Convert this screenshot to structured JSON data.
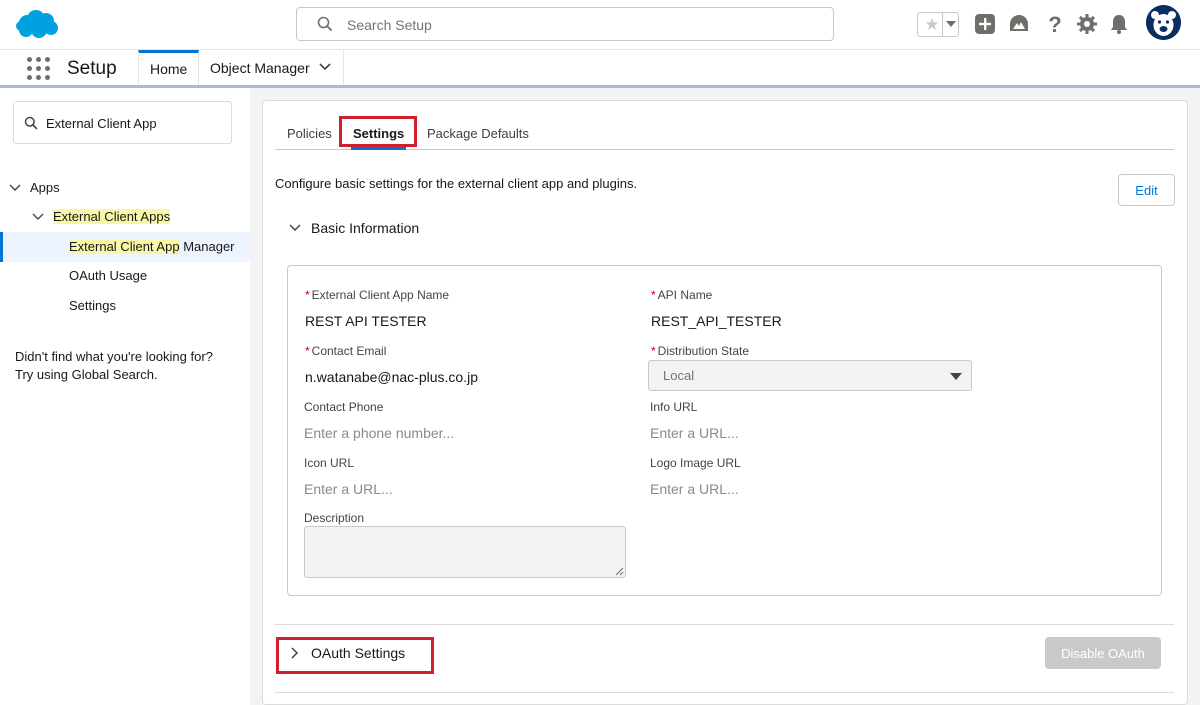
{
  "header": {
    "search_placeholder": "Search Setup",
    "icons": [
      "salesforce-cloud-logo",
      "search-icon",
      "favorites-star-icon",
      "add-icon",
      "trailhead-icon",
      "help-icon",
      "gear-icon",
      "bell-icon",
      "avatar"
    ]
  },
  "nav": {
    "app_name": "Setup",
    "tabs": [
      {
        "label": "Home"
      },
      {
        "label": "Object Manager"
      }
    ]
  },
  "sidebar": {
    "quickfind_value": "External Client App",
    "tree": [
      {
        "label": "Apps"
      },
      {
        "label": "External Client Apps"
      },
      {
        "label_hl": "External Client App",
        "label_rest": " Manager"
      },
      {
        "label": "OAuth Usage"
      },
      {
        "label": "Settings"
      }
    ],
    "help_line1": "Didn't find what you're looking for?",
    "help_line2": "Try using Global Search."
  },
  "main": {
    "tabs": [
      "Policies",
      "Settings",
      "Package Defaults"
    ],
    "active_tab": "Settings",
    "description": "Configure basic settings for the external client app and plugins.",
    "edit_label": "Edit",
    "basic_info_title": "Basic Information",
    "fields": {
      "app_name_label": "External Client App Name",
      "app_name_value": "REST API TESTER",
      "api_name_label": "API Name",
      "api_name_value": "REST_API_TESTER",
      "contact_email_label": "Contact Email",
      "contact_email_value": "n.watanabe@nac-plus.co.jp",
      "distribution_label": "Distribution State",
      "distribution_value": "Local",
      "contact_phone_label": "Contact Phone",
      "contact_phone_placeholder": "Enter a phone number...",
      "info_url_label": "Info URL",
      "info_url_placeholder": "Enter a URL...",
      "icon_url_label": "Icon URL",
      "icon_url_placeholder": "Enter a URL...",
      "logo_url_label": "Logo Image URL",
      "logo_url_placeholder": "Enter a URL...",
      "description_label": "Description",
      "required_mark": "*"
    },
    "oauth_title": "OAuth Settings",
    "disable_oauth_label": "Disable OAuth"
  },
  "colors": {
    "brand_blue": "#0176d3",
    "highlight": "#f9f6a6",
    "annotation_red": "#d0202e"
  }
}
